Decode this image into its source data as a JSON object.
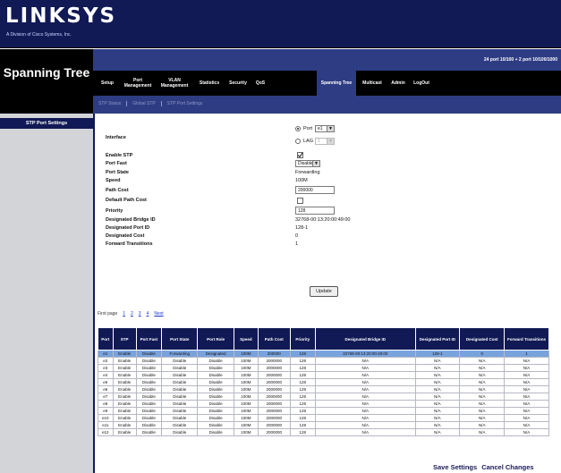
{
  "brand": {
    "logo": "LINKSYS",
    "subtitle": "A Division of Cisco Systems, Inc."
  },
  "header": {
    "page_title": "Spanning Tree",
    "port_info": "24 port 10/100 + 2 port 10/100/1000"
  },
  "menu": {
    "items": [
      {
        "label": "Setup"
      },
      {
        "label": "Port Management"
      },
      {
        "label": "VLAN Management"
      },
      {
        "label": "Statistics"
      },
      {
        "label": "Security"
      },
      {
        "label": "QoS"
      },
      {
        "label": "Spanning Tree"
      },
      {
        "label": "Multicast"
      },
      {
        "label": "Admin"
      },
      {
        "label": "LogOut"
      }
    ],
    "active_index": 6
  },
  "submenu": {
    "items": [
      "STP Status",
      "Global STP",
      "STP Port Settings"
    ]
  },
  "sidebar": {
    "items": [
      {
        "label": "STP Port Settings"
      }
    ]
  },
  "form": {
    "interface": {
      "label": "Interface",
      "port_label": "Port",
      "port_value": "e1",
      "lag_label": "LAG",
      "lag_value": "1",
      "selected": "Port"
    },
    "enable_stp": {
      "label": "Enable STP",
      "checked": true
    },
    "port_fast": {
      "label": "Port Fast",
      "value": "Disable"
    },
    "port_state": {
      "label": "Port State",
      "value": "Forwarding"
    },
    "speed": {
      "label": "Speed",
      "value": "100M"
    },
    "path_cost": {
      "label": "Path Cost",
      "value": "200000"
    },
    "default_path_cost": {
      "label": "Default Path Cost",
      "checked": false
    },
    "priority": {
      "label": "Priority",
      "value": "128"
    },
    "designated_bridge_id": {
      "label": "Designated Bridge ID",
      "value": "32768-00:13:20:00:49:00"
    },
    "designated_port_id": {
      "label": "Designated Port ID",
      "value": "128-1"
    },
    "designated_cost": {
      "label": "Designated Cost",
      "value": "0"
    },
    "forward_transitions": {
      "label": "Forward Transitions",
      "value": "1"
    },
    "update_button": "Update"
  },
  "pagination": {
    "label": "First page",
    "pages": [
      "1",
      "2",
      "3",
      "4"
    ],
    "next": "Next"
  },
  "table": {
    "headers": [
      "Port",
      "STP",
      "Port Fast",
      "Port State",
      "Port Role",
      "Speed",
      "Path Cost",
      "Priority",
      "Designated Bridge ID",
      "Designated Port ID",
      "Designated Cost",
      "Forward Transitions"
    ],
    "rows": [
      [
        "e1",
        "Enable",
        "Disable",
        "Forwarding",
        "Designated",
        "100M",
        "200000",
        "128",
        "32768-00:13:20:00:49:00",
        "128-1",
        "0",
        "1"
      ],
      [
        "e2",
        "Enable",
        "Disable",
        "Disable",
        "Disable",
        "100M",
        "2000000",
        "128",
        "N/A",
        "N/A",
        "N/A",
        "N/A"
      ],
      [
        "e3",
        "Enable",
        "Disable",
        "Disable",
        "Disable",
        "100M",
        "2000000",
        "128",
        "N/A",
        "N/A",
        "N/A",
        "N/A"
      ],
      [
        "e4",
        "Enable",
        "Disable",
        "Disable",
        "Disable",
        "100M",
        "2000000",
        "128",
        "N/A",
        "N/A",
        "N/A",
        "N/A"
      ],
      [
        "e5",
        "Enable",
        "Disable",
        "Disable",
        "Disable",
        "100M",
        "2000000",
        "128",
        "N/A",
        "N/A",
        "N/A",
        "N/A"
      ],
      [
        "e6",
        "Enable",
        "Disable",
        "Disable",
        "Disable",
        "100M",
        "2000000",
        "128",
        "N/A",
        "N/A",
        "N/A",
        "N/A"
      ],
      [
        "e7",
        "Enable",
        "Disable",
        "Disable",
        "Disable",
        "100M",
        "2000000",
        "128",
        "N/A",
        "N/A",
        "N/A",
        "N/A"
      ],
      [
        "e8",
        "Enable",
        "Disable",
        "Disable",
        "Disable",
        "100M",
        "2000000",
        "128",
        "N/A",
        "N/A",
        "N/A",
        "N/A"
      ],
      [
        "e9",
        "Enable",
        "Disable",
        "Disable",
        "Disable",
        "100M",
        "2000000",
        "128",
        "N/A",
        "N/A",
        "N/A",
        "N/A"
      ],
      [
        "e10",
        "Enable",
        "Disable",
        "Disable",
        "Disable",
        "100M",
        "2000000",
        "128",
        "N/A",
        "N/A",
        "N/A",
        "N/A"
      ],
      [
        "e11",
        "Enable",
        "Disable",
        "Disable",
        "Disable",
        "100M",
        "2000000",
        "128",
        "N/A",
        "N/A",
        "N/A",
        "N/A"
      ],
      [
        "e12",
        "Enable",
        "Disable",
        "Disable",
        "Disable",
        "100M",
        "2000000",
        "128",
        "N/A",
        "N/A",
        "N/A",
        "N/A"
      ]
    ],
    "selected_row": 0
  },
  "footer": {
    "save": "Save Settings",
    "cancel": "Cancel Changes"
  },
  "colors": {
    "header_bg": "#111a55",
    "nav_band": "#2e3c83",
    "menu_bg": "#000000",
    "sidebar_bg": "#d2d4d8",
    "selected_row": "#79a3dd"
  }
}
